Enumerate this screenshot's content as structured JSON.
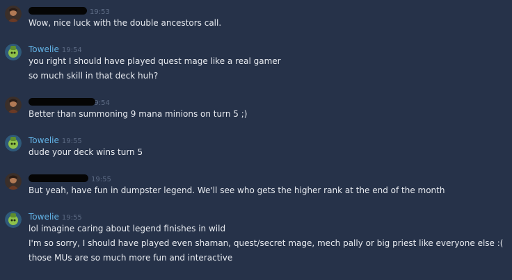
{
  "messages": [
    {
      "author": "",
      "redacted": true,
      "avatar": "hunter-portrait-icon",
      "time": "19:53",
      "lines": [
        "Wow, nice luck with the double ancestors call."
      ]
    },
    {
      "author": "Towelie",
      "redacted": false,
      "avatar": "towelie-portrait-icon",
      "time": "19:54",
      "lines": [
        "you right I should have played quest mage like a real gamer",
        "so much skill in that deck huh?"
      ]
    },
    {
      "author": "",
      "redacted": true,
      "avatar": "hunter-portrait-icon",
      "time": "19:54",
      "lines": [
        "Better than summoning 9 mana minions on turn 5 ;)"
      ]
    },
    {
      "author": "Towelie",
      "redacted": false,
      "avatar": "towelie-portrait-icon",
      "time": "19:55",
      "lines": [
        "dude your deck wins turn 5"
      ]
    },
    {
      "author": "",
      "redacted": true,
      "avatar": "hunter-portrait-icon",
      "time": "19:55",
      "lines": [
        "But yeah, have fun in dumpster legend. We'll see who gets the higher rank at the end of the month"
      ]
    },
    {
      "author": "Towelie",
      "redacted": false,
      "avatar": "towelie-portrait-icon",
      "time": "19:55",
      "lines": [
        "lol imagine caring about legend finishes in wild",
        "I'm so sorry, I should have played even shaman, quest/secret mage, mech pally or big priest like everyone else :(",
        "those MUs are so much more fun and interactive"
      ]
    }
  ]
}
